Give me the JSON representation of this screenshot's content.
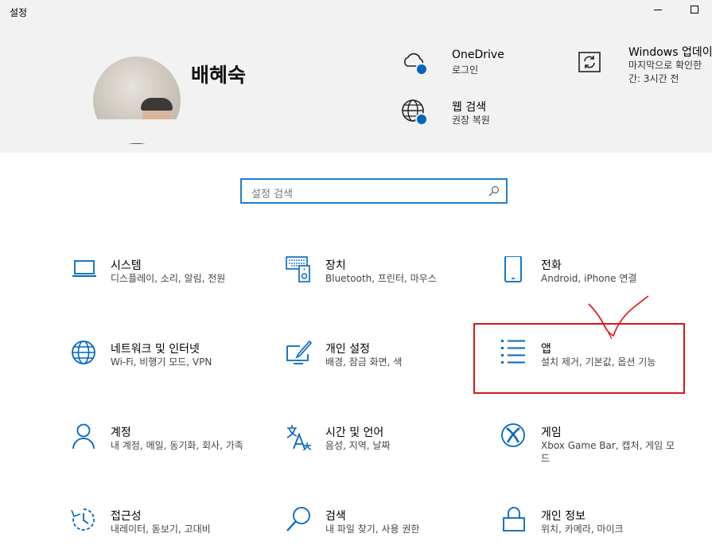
{
  "window": {
    "title": "설정"
  },
  "profile": {
    "name": "배혜숙"
  },
  "quick_status": [
    {
      "title": "OneDrive",
      "subtitle": "로그인",
      "icon": "cloud-icon"
    },
    {
      "title": "웹 검색",
      "subtitle": "권장 복원",
      "icon": "globe-icon"
    },
    {
      "title": "Windows 업데이",
      "subtitle_line1": "마지막으로 확인한",
      "subtitle_line2": "간: 3시간 전",
      "icon": "sync-icon"
    }
  ],
  "search": {
    "placeholder": "설정 검색"
  },
  "categories": [
    {
      "title": "시스템",
      "subtitle": "디스플레이, 소리, 알림, 전원",
      "icon": "laptop-icon"
    },
    {
      "title": "장치",
      "subtitle": "Bluetooth, 프린터, 마우스",
      "icon": "devices-icon"
    },
    {
      "title": "전화",
      "subtitle": "Android, iPhone 연결",
      "icon": "phone-icon"
    },
    {
      "title": "네트워크 및 인터넷",
      "subtitle": "Wi-Fi, 비행기 모드, VPN",
      "icon": "globe-icon"
    },
    {
      "title": "개인 설정",
      "subtitle": "배경, 잠금 화면, 색",
      "icon": "personalization-icon"
    },
    {
      "title": "앱",
      "subtitle": "설치 제거, 기본값, 옵션 기능",
      "icon": "apps-list-icon"
    },
    {
      "title": "계정",
      "subtitle": "내 계정, 메일, 동기화, 회사, 가족",
      "icon": "person-icon"
    },
    {
      "title": "시간 및 언어",
      "subtitle": "음성, 지역, 날짜",
      "icon": "time-language-icon"
    },
    {
      "title": "게임",
      "subtitle": "Xbox Game Bar, 캡처, 게임 모드",
      "icon": "xbox-icon"
    },
    {
      "title": "접근성",
      "subtitle": "내레이터, 돋보기, 고대비",
      "icon": "accessibility-icon"
    },
    {
      "title": "검색",
      "subtitle": "내 파일 찾기, 사용 권한",
      "icon": "search-icon"
    },
    {
      "title": "개인 정보",
      "subtitle": "위치, 카메라, 마이크",
      "icon": "lock-icon"
    }
  ],
  "colors": {
    "accent": "#0067c0",
    "header_bg": "#f2f2f2",
    "annotation": "#d9141b"
  }
}
